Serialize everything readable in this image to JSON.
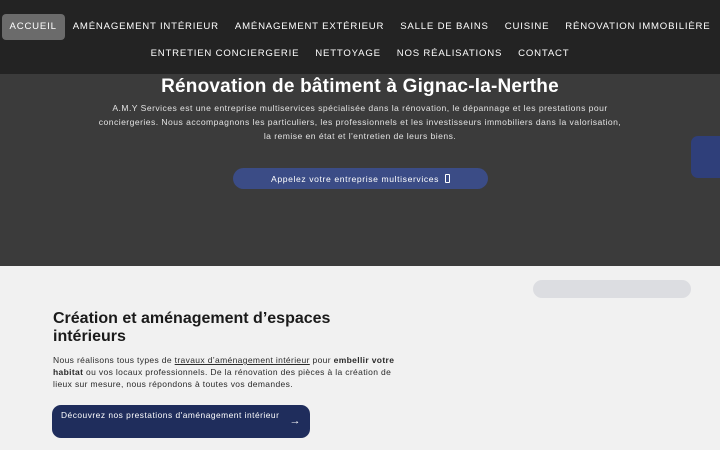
{
  "nav": {
    "row1": [
      "ACCUEIL",
      "AMÉNAGEMENT INTÉRIEUR",
      "AMÉNAGEMENT EXTÉRIEUR",
      "SALLE DE BAINS",
      "CUISINE",
      "RÉNOVATION IMMOBILIÈRE"
    ],
    "row2": [
      "ENTRETIEN CONCIERGERIE",
      "NETTOYAGE",
      "NOS RÉALISATIONS",
      "CONTACT"
    ],
    "active": "ACCUEIL"
  },
  "hero": {
    "title": "Rénovation de bâtiment à Gignac-la-Nerthe",
    "text": "A.M.Y Services est une entreprise multiservices spécialisée dans la rénovation, le dépannage et les prestations pour conciergeries. Nous accompagnons les particuliers, les professionnels et les investisseurs immobiliers dans la valorisation, la remise en état et l'entretien de leurs biens.",
    "cta_label": "Appelez votre entreprise multiservices",
    "cta_icon": "phone-icon"
  },
  "section": {
    "title": "Création et aménagement d’espaces intérieurs",
    "text_before": "Nous réalisons tous types de ",
    "link_text": "travaux d’aménagement intérieur",
    "text_middle": " pour ",
    "bold_text": "embellir votre habitat",
    "text_after": " ou vos locaux professionnels. De la rénovation des pièces à la création de lieux sur mesure, nous répondons à toutes vos demandes.",
    "button_label": "Découvrez nos prestations d'aménagement intérieur",
    "button_icon": "arrow-right-icon",
    "arrow": "→"
  },
  "colors": {
    "nav_bg": "#232323",
    "hero_bg": "#3b3b3b",
    "cta_bg": "#3b4c86",
    "section_button_bg": "#1f2d5c",
    "page_bg": "#f1f1f1"
  }
}
